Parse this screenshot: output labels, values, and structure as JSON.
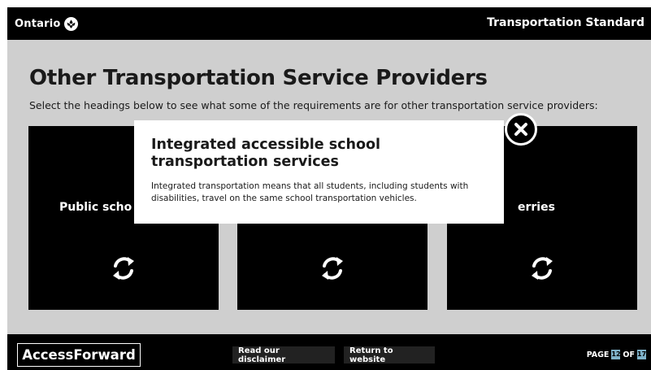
{
  "header": {
    "brand": "Ontario",
    "brand_icon": "trillium-icon",
    "title": "Transportation Standard"
  },
  "main": {
    "title": "Other Transportation Service Providers",
    "instructions": "Select the headings below to see what some of the requirements are for other transportation service providers:",
    "cards": [
      {
        "label": "Public scho",
        "icon": "refresh-icon"
      },
      {
        "label": "",
        "icon": "refresh-icon"
      },
      {
        "label": "erries",
        "icon": "refresh-icon"
      }
    ]
  },
  "modal": {
    "title": "Integrated accessible school transportation services",
    "body": "Integrated transportation means that all students, including students with disabilities, travel on the same school transportation vehicles.",
    "close_icon": "close-icon"
  },
  "footer": {
    "brand": "AccessForward",
    "disclaimer_label": "Read our disclaimer",
    "return_label": "Return to website",
    "page_prefix": "PAGE",
    "page_current": "12",
    "page_of": "OF",
    "page_total": "17"
  },
  "colors": {
    "bar": "#000000",
    "background": "#cfcfcf",
    "modal": "#ffffff",
    "page_indicator": "#7fb2c9"
  }
}
